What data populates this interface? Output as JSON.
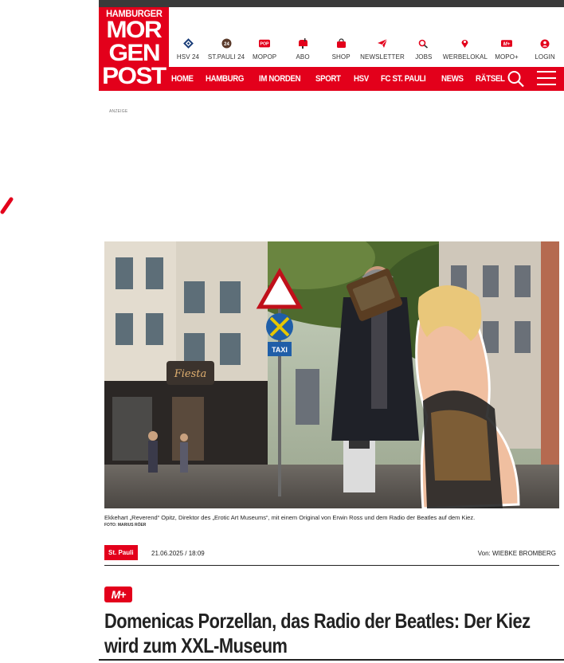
{
  "brand": {
    "logo_line1": "HAMBURGER",
    "logo_line2": "MOR",
    "logo_line3": "GEN",
    "logo_line4": "POST",
    "red": "#e3001b",
    "dark": "#3a3a3a"
  },
  "utility_nav": [
    {
      "label": "HSV 24",
      "icon": "hsv-icon"
    },
    {
      "label": "ST.PAULI 24",
      "icon": "stpauli-icon"
    },
    {
      "label": "MOPOP",
      "icon": "mopop-icon"
    },
    {
      "label": "ABO",
      "icon": "mailbox-icon"
    },
    {
      "label": "SHOP",
      "icon": "bag-icon"
    },
    {
      "label": "NEWSLETTER",
      "icon": "newsletter-icon"
    },
    {
      "label": "JOBS",
      "icon": "jobs-icon"
    },
    {
      "label": "WERBELOKAL",
      "icon": "pin-icon"
    },
    {
      "label": "MOPO+",
      "icon": "mopo-plus-icon"
    },
    {
      "label": "LOGIN",
      "icon": "user-icon"
    }
  ],
  "main_nav": [
    "HOME",
    "HAMBURG",
    "IM NORDEN",
    "SPORT",
    "HSV",
    "FC ST. PAULI",
    "NEWS",
    "RÄTSEL"
  ],
  "ad_label": "ANZEIGE",
  "hero": {
    "caption": "Ekkehart „Reverend“ Opitz, Direktor des „Erotic Art Museums“, mit einem Original von Erwin Ross und dem Radio der Beatles auf dem Kiez.",
    "credit": "FOTO: MARIUS RÖER"
  },
  "meta": {
    "tag": "St. Pauli",
    "date": "21.06.2025 / 18:09",
    "author": "Von: WIEBKE BROMBERG"
  },
  "premium_badge": "M+",
  "headline": "Domenicas Porzellan, das Radio der Beatles: Der Kiez wird zum XXL-Museum"
}
